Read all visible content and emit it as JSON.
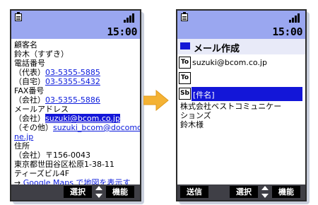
{
  "colors": {
    "status_bar": "#9aa7f0",
    "link": "#0b1bdc",
    "highlight": "#1316d8",
    "softkey_bar": "#3f3f46",
    "arrow": "#f4b234"
  },
  "left_screen": {
    "clock": "15:00",
    "lines": [
      {
        "text": "顧客名"
      },
      {
        "text": "鈴木（すずき）"
      },
      {
        "text": "電話番号"
      },
      {
        "prefix": "（代表）",
        "link": "03-5355-5885"
      },
      {
        "prefix": "（自宅）",
        "link": "03-5355-5432"
      },
      {
        "text": "FAX番号"
      },
      {
        "prefix": "（会社）",
        "link": "03-5355-5886"
      },
      {
        "text": "メールアドレス"
      },
      {
        "prefix": "（会社）",
        "link": "suzuki@bcom.co.jp",
        "selected": true
      },
      {
        "prefix": "（その他）",
        "link": "suzuki_bcom@docomo."
      },
      {
        "link": "ne.jp"
      },
      {
        "text": "住所"
      },
      {
        "text": "（会社）〒156-0043"
      },
      {
        "text": "東京都世田谷区松原1-38-11"
      },
      {
        "text": "ティーズビル4F"
      },
      {
        "prefix": "→ ",
        "link": "Google Maps で地図を表示す"
      }
    ],
    "softkeys": {
      "center": "選択",
      "right": "機能"
    }
  },
  "right_screen": {
    "clock": "15:00",
    "title": "メール作成",
    "fields": [
      {
        "label": "To",
        "value": "suzuki@bcom.co.jp"
      },
      {
        "label": "To",
        "value": ""
      },
      {
        "label": "Sb",
        "value": "[件名]",
        "selected": true
      }
    ],
    "body_lines": [
      "株式会社ベストコミュニケー",
      "ションズ",
      "鈴木様"
    ],
    "softkeys": {
      "left": "送信",
      "center": "選択",
      "right": "機能"
    }
  }
}
